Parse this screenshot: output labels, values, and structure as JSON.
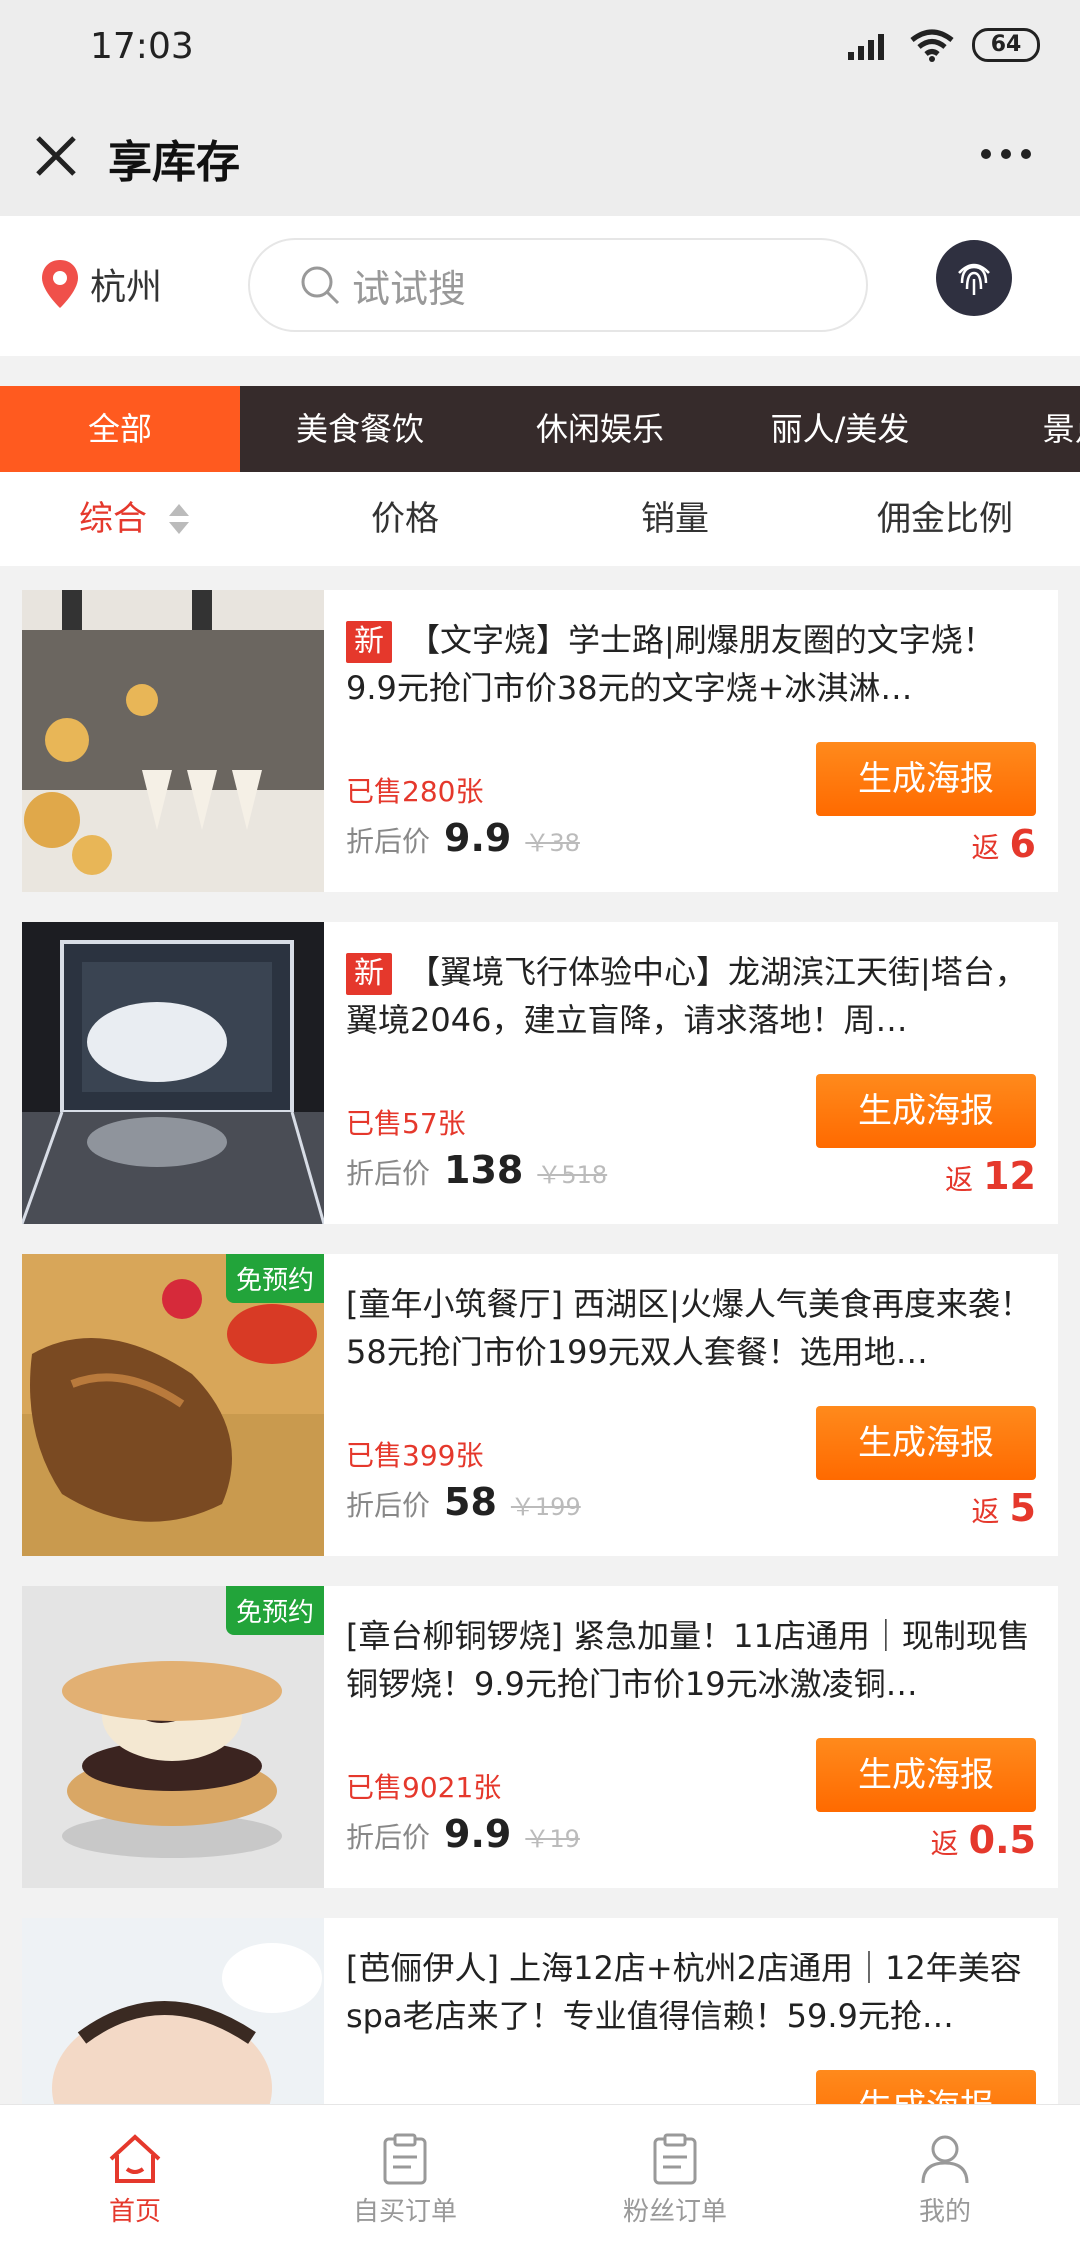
{
  "status": {
    "time": "17:03",
    "battery": "64"
  },
  "header": {
    "title": "享库存"
  },
  "location": {
    "city": "杭州"
  },
  "search": {
    "placeholder": "试试搜"
  },
  "categories": [
    "全部",
    "美食餐饮",
    "休闲娱乐",
    "丽人/美发",
    "景点/"
  ],
  "sorts": [
    "综合",
    "价格",
    "销量",
    "佣金比例"
  ],
  "labels": {
    "after_discount": "折后价",
    "generate": "生成海报",
    "return": "返",
    "new": "新",
    "free_booking": "免预约"
  },
  "products": [
    {
      "title": "【文字烧】学士路|刷爆朋友圈的文字烧！9.9元抢门市价38元的文字烧+冰淇淋…",
      "sold": "已售280张",
      "price": "9.9",
      "orig": "￥38",
      "ret": "6"
    },
    {
      "title": "【翼境飞行体验中心】龙湖滨江天街|塔台，翼境2046，建立盲降，请求落地！周…",
      "sold": "已售57张",
      "price": "138",
      "orig": "￥518",
      "ret": "12"
    },
    {
      "title": "[童年小筑餐厅] 西湖区|火爆人气美食再度来袭！58元抢门市价199元双人套餐！选用地…",
      "sold": "已售399张",
      "price": "58",
      "orig": "￥199",
      "ret": "5"
    },
    {
      "title": "[章台柳铜锣烧] 紧急加量！11店通用｜现制现售铜锣烧！9.9元抢门市价19元冰激凌铜…",
      "sold": "已售9021张",
      "price": "9.9",
      "orig": "￥19",
      "ret": "0.5"
    },
    {
      "title": "[芭俪伊人] 上海12店+杭州2店通用｜12年美容spa老店来了！专业值得信赖！59.9元抢…"
    }
  ],
  "tabs": [
    "首页",
    "自买订单",
    "粉丝订单",
    "我的"
  ],
  "colors": {
    "accent": "#e5382c",
    "active_category": "#ff5a1f",
    "category_bar": "#362b2b",
    "button": "#ff7a10",
    "free_badge": "#22a43a"
  }
}
